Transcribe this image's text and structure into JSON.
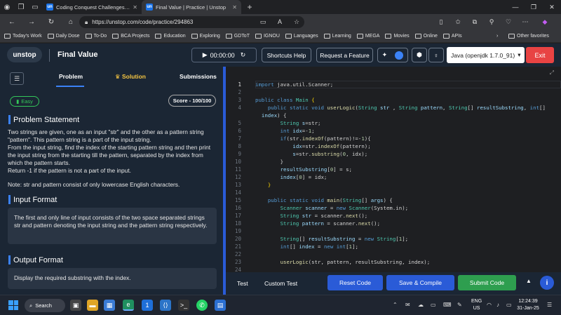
{
  "browser": {
    "tabs": [
      {
        "title": "Coding Conquest Challenges | Le",
        "favicon": "un",
        "active": false
      },
      {
        "title": "Final Value | Practice | Unstop",
        "favicon": "un",
        "active": true
      }
    ],
    "new_tab": "+",
    "url": "https://unstop.com/code/practice/294863",
    "bookmarks": [
      "Today's Work",
      "Daily Dose",
      "To-Do",
      "BCA Projects",
      "Education",
      "Exploring",
      "GDToT",
      "IGNOU",
      "Languages",
      "Learning",
      "MEGA",
      "Movies",
      "Online",
      "APIs"
    ],
    "other_favorites": "Other favorites"
  },
  "header": {
    "logo": "unstop",
    "title": "Final Value",
    "timer": "00:00:00",
    "shortcuts_label": "Shortcuts Help",
    "request_label": "Request a Feature",
    "language": "Java (openjdk 1.7.0_91)",
    "exit_label": "Exit"
  },
  "left": {
    "tabs": [
      "Problem",
      "Solution",
      "Submissions"
    ],
    "active_tab": "Problem",
    "difficulty": "Easy",
    "score": "Score - 100/100",
    "problem_heading": "Problem Statement",
    "problem_paras": [
      "Two strings are given, one as an input \"str\" and the other as a pattern string \"pattern\". This pattern string is a part of the input string.",
      "From the input string, find the index of the starting pattern string and then print the input string from the starting till the pattern, separated by the index from which the pattern starts.",
      "Return -1 if the pattern is not a part of the input.",
      "Note: str and pattern consist of only lowercase English characters."
    ],
    "input_heading": "Input Format",
    "input_text": "The first and only line of input consists of the two space separated strings str and pattern denoting the input string and the pattern string respectively.",
    "output_heading": "Output Format",
    "output_text": "Display the required substring with the index."
  },
  "editor": {
    "line_numbers": [
      "1",
      "2",
      "3",
      "4",
      "",
      "5",
      "6",
      "7",
      "8",
      "9",
      "10",
      "11",
      "12",
      "13",
      "14",
      "15",
      "16",
      "17",
      "18",
      "19",
      "20",
      "21",
      "22",
      "23",
      "24"
    ],
    "current_line": "1"
  },
  "bottom": {
    "test_label": "Test",
    "custom_test_label": "Custom Test",
    "reset_label": "Reset Code",
    "save_label": "Save & Compile",
    "submit_label": "Submit Code",
    "info_label": "i"
  },
  "taskbar": {
    "search_label": "Search",
    "badge_count": "1",
    "lang_line1": "ENG",
    "lang_line2": "US",
    "time": "12:24:39",
    "date": "31-Jan-25"
  },
  "colors": {
    "accent_blue": "#2a5bd7",
    "submit_green": "#2e9e4f",
    "exit_red": "#e84343",
    "easy_green": "#34c759"
  }
}
